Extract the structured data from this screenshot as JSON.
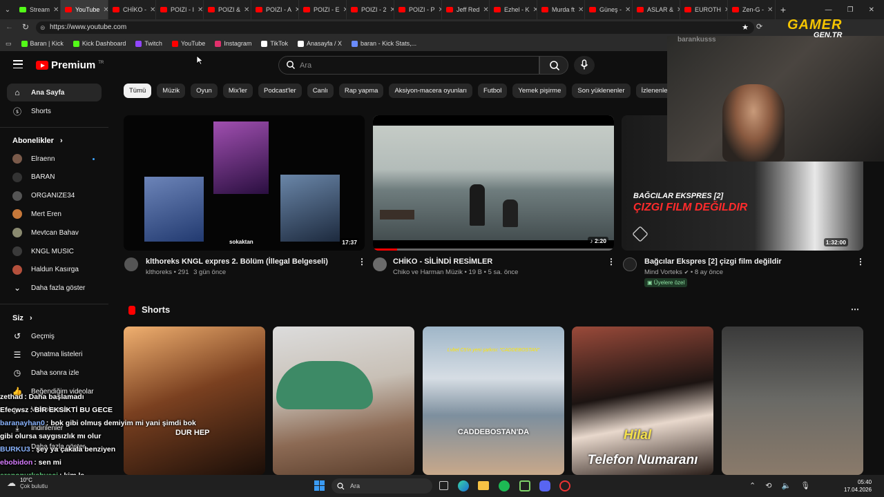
{
  "tabs": [
    {
      "label": "Stream",
      "icon": "kick-icon",
      "color": "#53fc18",
      "active": false
    },
    {
      "label": "YouTube",
      "icon": "youtube-icon",
      "color": "#ff0000",
      "active": true
    },
    {
      "label": "CHİKO -",
      "icon": "youtube-icon",
      "color": "#ff0000",
      "active": false
    },
    {
      "label": "POIZI - I",
      "icon": "youtube-icon",
      "color": "#ff0000",
      "active": false
    },
    {
      "label": "POIZI &",
      "icon": "youtube-icon",
      "color": "#ff0000",
      "active": false
    },
    {
      "label": "POIZI - A",
      "icon": "youtube-icon",
      "color": "#ff0000",
      "active": false
    },
    {
      "label": "POIZI - E",
      "icon": "youtube-icon",
      "color": "#ff0000",
      "active": false
    },
    {
      "label": "POIZI - 2",
      "icon": "youtube-icon",
      "color": "#ff0000",
      "active": false
    },
    {
      "label": "POIZI - P",
      "icon": "youtube-icon",
      "color": "#ff0000",
      "active": false
    },
    {
      "label": "Jeff Red",
      "icon": "youtube-icon",
      "color": "#ff0000",
      "active": false
    },
    {
      "label": "Ezhel - K",
      "icon": "youtube-icon",
      "color": "#ff0000",
      "active": false
    },
    {
      "label": "Murda ft",
      "icon": "youtube-icon",
      "color": "#ff0000",
      "active": false
    },
    {
      "label": "Güneş -",
      "icon": "youtube-icon",
      "color": "#ff0000",
      "active": false
    },
    {
      "label": "ASLAR &",
      "icon": "youtube-icon",
      "color": "#ff0000",
      "active": false
    },
    {
      "label": "EUROTH",
      "icon": "youtube-icon",
      "color": "#ff0000",
      "active": false
    },
    {
      "label": "Zen-G -",
      "icon": "youtube-icon",
      "color": "#ff0000",
      "active": false
    }
  ],
  "address": {
    "url": "https://www.youtube.com"
  },
  "bookmarks": [
    {
      "label": "Baran | Kick",
      "color": "#53fc18"
    },
    {
      "label": "Kick Dashboard",
      "color": "#53fc18"
    },
    {
      "label": "Twitch",
      "color": "#9146ff"
    },
    {
      "label": "YouTube",
      "color": "#ff0000"
    },
    {
      "label": "Instagram",
      "color": "#e1306c"
    },
    {
      "label": "TikTok",
      "color": "#ffffff"
    },
    {
      "label": "Anasayfa / X",
      "color": "#ffffff"
    },
    {
      "label": "baran - Kick Stats,...",
      "color": "#6a8cff"
    }
  ],
  "header": {
    "logo_text": "Premium",
    "logo_suffix": "TR",
    "search_placeholder": "Ara"
  },
  "sidebar": {
    "home": "Ana Sayfa",
    "shorts": "Shorts",
    "subs_heading": "Abonelikler",
    "subscriptions": [
      {
        "name": "Elraenn",
        "color": "#7a5a4a",
        "live_dot": true
      },
      {
        "name": "BARAN",
        "color": "#333333",
        "live_dot": false
      },
      {
        "name": "ORGANIZE34",
        "color": "#555555",
        "live_dot": false
      },
      {
        "name": "Mert Eren",
        "color": "#c6783a",
        "live_dot": false
      },
      {
        "name": "Mevtcan Bahav",
        "color": "#8a8a70",
        "live_dot": false
      },
      {
        "name": "KNGL MUSIC",
        "color": "#3a3a3a",
        "live_dot": false
      },
      {
        "name": "Haldun Kasırga",
        "color": "#b4503c",
        "live_dot": false
      }
    ],
    "show_more": "Daha fazla göster",
    "you_heading": "Siz",
    "you_items": [
      "Geçmiş",
      "Oynatma listeleri",
      "Daha sonra izle",
      "Beğendiğim videolar",
      "Videolarınız",
      "İndirilenler",
      "Daha fazla göster"
    ]
  },
  "chips": [
    "Tümü",
    "Müzik",
    "Oyun",
    "Mix'ler",
    "Podcast'ler",
    "Canlı",
    "Rap yapma",
    "Aksiyon-macera oyunları",
    "Futbol",
    "Yemek pişirme",
    "Son yüklenenler",
    "İzlenenler"
  ],
  "videos": [
    {
      "title": "klthoreks KNGL expres 2. Bölüm (İllegal Belgeseli)",
      "channel": "klthoreks",
      "views": "291",
      "age": "3 gün önce",
      "duration": "17:37",
      "thumb_caption": "sokaktan"
    },
    {
      "title": "CHİKO - SİLİNDİ RESİMLER",
      "channel": "Chiko ve Harman Müzik",
      "views": "19 B",
      "age": "5 sa. önce",
      "duration": "2:20",
      "watched_progress": 0.1
    },
    {
      "title": "Bağcılar Ekspres [2] çizgi film değildir",
      "channel": "Mind Vorteks",
      "views": "",
      "age": "8 ay önce",
      "duration": "1:32:00",
      "badge": "Üyelere özel",
      "thumb_title_1": "BAĞCILAR EKSPRES [2]",
      "thumb_title_2": "ÇIZGI FILM DEĞILDIR"
    }
  ],
  "shorts_section": {
    "title": "Shorts",
    "items": [
      {
        "caption": "DUR HEP"
      },
      {
        "caption": ""
      },
      {
        "caption": "CADDEBOSTAN'DA",
        "top_caption": "Lvbel C5'in yeni şarkısı: \"CADDEBOSTAN\""
      },
      {
        "caption": "Telefon Numaranı",
        "name_tag": "Hilal"
      },
      {
        "caption": ""
      }
    ]
  },
  "webcam": {
    "overlay_name": "barankusss",
    "brand_1": "GAMER",
    "brand_2": "GEN.TR"
  },
  "chat": [
    {
      "user": "zethad",
      "message": ": Daha başlamadı",
      "color": "#ffffff"
    },
    {
      "user": "Efecwsz",
      "message": ": BİR EKSİKTİ BU GECE",
      "color": "#ffffff"
    },
    {
      "user": "baranayhan0",
      "message": ": bok gibi olmuş demiyim mi yani şimdi bok",
      "color": "#8ab4ff"
    },
    {
      "user": "",
      "message": "gibi olursa saygısızlık mı olur",
      "color": "#ffffff"
    },
    {
      "user": "BURKU3",
      "message": ": şey ya çakala benziyen",
      "color": "#8ab4ff"
    },
    {
      "user": "ebobidon",
      "message": ": sen mi",
      "color": "#d77cff"
    },
    {
      "user": "erenonurkahveci",
      "message": ": kim la",
      "color": "#5ec97a"
    }
  ],
  "taskbar": {
    "weather_temp": "10°C",
    "weather_text": "Çok bulutlu",
    "search": "Ara",
    "time": "05:40",
    "date": "17.04.2026"
  }
}
